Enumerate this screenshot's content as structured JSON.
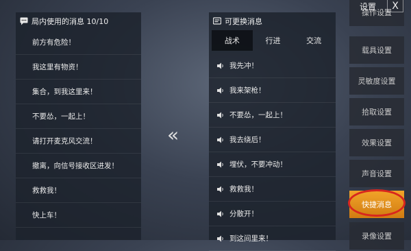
{
  "in_use_panel": {
    "title": "局内使用的消息 10/10",
    "messages": [
      "前方有危险！",
      "我这里有物资！",
      "集合，到我这里来！",
      "不要怂，一起上！",
      "请打开麦克风交流！",
      "撤离，向信号接收区进发！",
      "救救我！",
      "快上车！"
    ]
  },
  "available_panel": {
    "title": "可更换消息",
    "tabs": [
      "战术",
      "行进",
      "交流"
    ],
    "active_tab": "战术",
    "messages": [
      "我先冲！",
      "我来架枪！",
      "不要怂，一起上！",
      "我去绕后！",
      "埋伏，不要冲动！",
      "救救我！",
      "分散开！",
      "到这间里来！"
    ]
  },
  "move_arrow": "«",
  "settings": {
    "title": "设置",
    "close": "X",
    "menu": [
      "操作设置",
      "载具设置",
      "灵敏度设置",
      "拾取设置",
      "效果设置",
      "声音设置",
      "快捷消息",
      "录像设置"
    ],
    "active": "快捷消息"
  },
  "colors": {
    "accent": "#f2a429",
    "highlight_ring": "#d8261e"
  },
  "icons": {
    "header_left": "chat-bubble-icon",
    "header_right": "message-list-icon",
    "row": "speaker-icon"
  }
}
